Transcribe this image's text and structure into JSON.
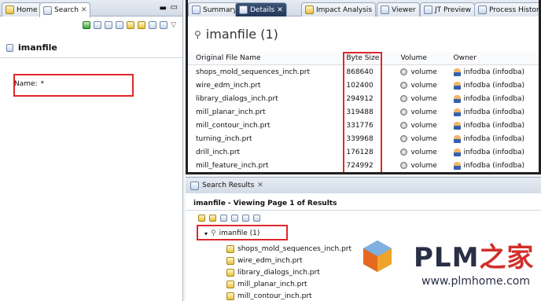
{
  "left_tabs": {
    "home": "Home",
    "search": "Search"
  },
  "left_panel": {
    "title": "imanfile",
    "name_label": "Name:",
    "name_value": "*"
  },
  "right_tabs": [
    "Summary",
    "Details",
    "Impact Analysis",
    "Viewer",
    "JT Preview",
    "Process History"
  ],
  "details": {
    "title": "imanfile (1)",
    "columns": [
      "Original File Name",
      "Byte Size",
      "Volume",
      "Owner"
    ],
    "rows": [
      {
        "name": "shops_mold_sequences_inch.prt",
        "size": "868640",
        "volume": "volume",
        "owner": "infodba (infodba)"
      },
      {
        "name": "wire_edm_inch.prt",
        "size": "102400",
        "volume": "volume",
        "owner": "infodba (infodba)"
      },
      {
        "name": "library_dialogs_inch.prt",
        "size": "294912",
        "volume": "volume",
        "owner": "infodba (infodba)"
      },
      {
        "name": "mill_planar_inch.prt",
        "size": "319488",
        "volume": "volume",
        "owner": "infodba (infodba)"
      },
      {
        "name": "mill_contour_inch.prt",
        "size": "331776",
        "volume": "volume",
        "owner": "infodba (infodba)"
      },
      {
        "name": "turning_inch.prt",
        "size": "339968",
        "volume": "volume",
        "owner": "infodba (infodba)"
      },
      {
        "name": "drill_inch.prt",
        "size": "176128",
        "volume": "volume",
        "owner": "infodba (infodba)"
      },
      {
        "name": "mill_feature_inch.prt",
        "size": "724992",
        "volume": "volume",
        "owner": "infodba (infodba)"
      }
    ]
  },
  "search_results": {
    "tab": "Search Results",
    "subtitle": "imanfile - Viewing Page 1 of Results",
    "root": "imanfile (1)",
    "items": [
      "shops_mold_sequences_inch.prt",
      "wire_edm_inch.prt",
      "library_dialogs_inch.prt",
      "mill_planar_inch.prt",
      "mill_contour_inch.prt"
    ]
  },
  "watermark": {
    "brand": "PLM",
    "brand_cn": "之家",
    "url": "www.plmhome.com"
  },
  "colors": {
    "highlight": "#e0262a",
    "accent": "#3b5377"
  }
}
